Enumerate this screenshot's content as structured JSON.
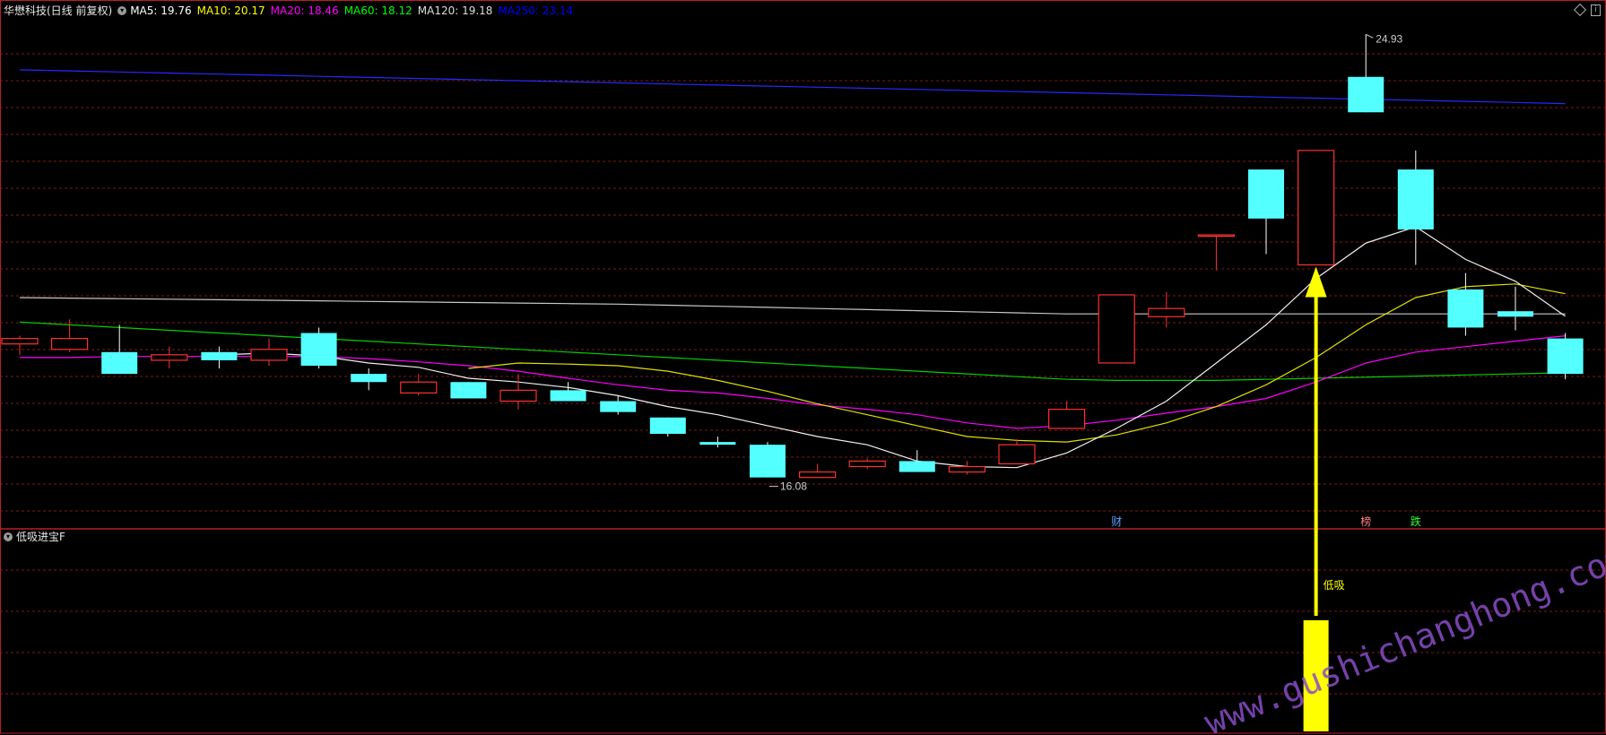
{
  "main_panel": {
    "title": "华懋科技(日线 前复权)",
    "indicators": [
      {
        "label": "MA5: 19.76",
        "color": "#ffffff"
      },
      {
        "label": "MA10: 20.17",
        "color": "#ffff00"
      },
      {
        "label": "MA20: 18.46",
        "color": "#ff00ff"
      },
      {
        "label": "MA60: 18.12",
        "color": "#00ff00"
      },
      {
        "label": "MA120: 19.18",
        "color": "#dddddd"
      },
      {
        "label": "MA250: 23.14",
        "color": "#0000ff"
      }
    ],
    "high_label": "24.93",
    "low_label": "16.08",
    "markers": [
      {
        "text": "财",
        "color": "#5aa0ff",
        "index": 22
      },
      {
        "text": "榜",
        "color": "#ff8080",
        "index": 27
      },
      {
        "text": "跌",
        "color": "#30ff30",
        "index": 28
      }
    ]
  },
  "sub_panel": {
    "title": "低吸进宝F",
    "signal_label": "低吸",
    "signal_index": 26
  },
  "watermark": "www.gushichanghong.com",
  "colors": {
    "up": "#ff3030",
    "down": "#54ffff",
    "grid": "#801818",
    "border": "#b82020",
    "signal": "#ffff00"
  },
  "chart_data": {
    "type": "candlestick",
    "title": "华懋科技(日线 前复权)",
    "candles": [
      {
        "o": 19.25,
        "h": 19.4,
        "l": 19.05,
        "c": 19.35
      },
      {
        "o": 19.15,
        "h": 19.7,
        "l": 19.1,
        "c": 19.35
      },
      {
        "o": 19.1,
        "h": 19.6,
        "l": 18.8,
        "c": 18.7
      },
      {
        "o": 18.95,
        "h": 19.2,
        "l": 18.8,
        "c": 19.05
      },
      {
        "o": 19.1,
        "h": 19.2,
        "l": 18.8,
        "c": 18.95
      },
      {
        "o": 18.95,
        "h": 19.35,
        "l": 18.85,
        "c": 19.15
      },
      {
        "o": 19.45,
        "h": 19.55,
        "l": 18.8,
        "c": 18.85
      },
      {
        "o": 18.7,
        "h": 18.8,
        "l": 18.4,
        "c": 18.55
      },
      {
        "o": 18.35,
        "h": 18.7,
        "l": 18.3,
        "c": 18.55
      },
      {
        "o": 18.55,
        "h": 18.55,
        "l": 18.25,
        "c": 18.25
      },
      {
        "o": 18.2,
        "h": 18.7,
        "l": 18.05,
        "c": 18.4
      },
      {
        "o": 18.4,
        "h": 18.55,
        "l": 18.2,
        "c": 18.2
      },
      {
        "o": 18.2,
        "h": 18.3,
        "l": 17.95,
        "c": 18.0
      },
      {
        "o": 17.9,
        "h": 17.9,
        "l": 17.55,
        "c": 17.6
      },
      {
        "o": 17.45,
        "h": 17.55,
        "l": 17.35,
        "c": 17.4
      },
      {
        "o": 17.4,
        "h": 17.45,
        "l": 16.8,
        "c": 16.8
      },
      {
        "o": 16.8,
        "h": 17.05,
        "l": 16.8,
        "c": 16.9
      },
      {
        "o": 17.0,
        "h": 17.15,
        "l": 16.95,
        "c": 17.1
      },
      {
        "o": 17.1,
        "h": 17.3,
        "l": 16.9,
        "c": 16.9
      },
      {
        "o": 16.9,
        "h": 17.1,
        "l": 16.85,
        "c": 17.0
      },
      {
        "o": 17.05,
        "h": 17.5,
        "l": 17.05,
        "c": 17.4
      },
      {
        "o": 17.7,
        "h": 18.2,
        "l": 17.7,
        "c": 18.05
      },
      {
        "o": 18.9,
        "h": 20.15,
        "l": 18.9,
        "c": 20.15
      },
      {
        "o": 19.75,
        "h": 20.2,
        "l": 19.55,
        "c": 19.9
      },
      {
        "o": 21.25,
        "h": 21.25,
        "l": 20.6,
        "c": 21.25
      },
      {
        "o": 22.45,
        "h": 22.45,
        "l": 20.9,
        "c": 21.55
      },
      {
        "o": 20.7,
        "h": 22.8,
        "l": 20.7,
        "c": 22.8
      },
      {
        "o": 24.15,
        "h": 24.93,
        "l": 23.5,
        "c": 23.5
      },
      {
        "o": 22.45,
        "h": 22.8,
        "l": 20.7,
        "c": 21.35
      },
      {
        "o": 20.25,
        "h": 20.55,
        "l": 19.4,
        "c": 19.55
      },
      {
        "o": 19.85,
        "h": 20.3,
        "l": 19.5,
        "c": 19.75
      },
      {
        "o": 19.35,
        "h": 19.45,
        "l": 18.6,
        "c": 18.7
      }
    ],
    "ma5": [
      null,
      null,
      null,
      null,
      19.05,
      19.08,
      19.03,
      18.9,
      18.82,
      18.62,
      18.55,
      18.45,
      18.3,
      18.1,
      17.95,
      17.75,
      17.55,
      17.4,
      17.1,
      17.0,
      16.98,
      17.25,
      17.7,
      18.2,
      18.9,
      19.6,
      20.45,
      21.1,
      21.4,
      20.8,
      20.4,
      19.76
    ],
    "ma10": [
      null,
      null,
      null,
      null,
      null,
      null,
      null,
      null,
      null,
      18.8,
      18.9,
      18.88,
      18.85,
      18.75,
      18.58,
      18.38,
      18.15,
      17.95,
      17.75,
      17.55,
      17.48,
      17.45,
      17.58,
      17.8,
      18.1,
      18.5,
      19.0,
      19.6,
      20.1,
      20.3,
      20.35,
      20.17
    ],
    "ma20": [
      19.0,
      19.0,
      19.02,
      19.02,
      19.02,
      19.02,
      19.02,
      18.98,
      18.92,
      18.85,
      18.75,
      18.62,
      18.5,
      18.4,
      18.35,
      18.25,
      18.13,
      18.05,
      17.95,
      17.8,
      17.7,
      17.75,
      17.85,
      17.98,
      18.1,
      18.25,
      18.55,
      18.9,
      19.1,
      19.2,
      19.3,
      19.4
    ],
    "ma60": [
      19.65,
      19.6,
      19.55,
      19.5,
      19.45,
      19.4,
      19.35,
      19.3,
      19.25,
      19.2,
      19.15,
      19.1,
      19.05,
      19.0,
      18.95,
      18.9,
      18.85,
      18.8,
      18.75,
      18.7,
      18.65,
      18.6,
      18.58,
      18.58,
      18.58,
      18.6,
      18.62,
      18.64,
      18.66,
      18.68,
      18.7,
      18.72
    ],
    "ma120": [
      20.1,
      20.09,
      20.08,
      20.07,
      20.06,
      20.05,
      20.04,
      20.03,
      20.02,
      20.01,
      20.0,
      19.99,
      19.98,
      19.96,
      19.94,
      19.92,
      19.9,
      19.88,
      19.86,
      19.84,
      19.82,
      19.8,
      19.8,
      19.8,
      19.8,
      19.8,
      19.8,
      19.8,
      19.8,
      19.8,
      19.8,
      19.8
    ],
    "ma250": [
      24.28,
      24.26,
      24.24,
      24.22,
      24.2,
      24.18,
      24.16,
      24.14,
      24.12,
      24.1,
      24.08,
      24.06,
      24.04,
      24.02,
      24.0,
      23.98,
      23.96,
      23.94,
      23.92,
      23.9,
      23.88,
      23.86,
      23.84,
      23.82,
      23.8,
      23.78,
      23.76,
      23.74,
      23.72,
      23.7,
      23.68,
      23.66
    ],
    "signals": [
      0,
      0,
      0,
      0,
      0,
      0,
      0,
      0,
      0,
      0,
      0,
      0,
      0,
      0,
      0,
      0,
      0,
      0,
      0,
      0,
      0,
      0,
      0,
      0,
      0,
      0,
      1,
      0,
      0,
      0,
      0,
      0
    ]
  }
}
